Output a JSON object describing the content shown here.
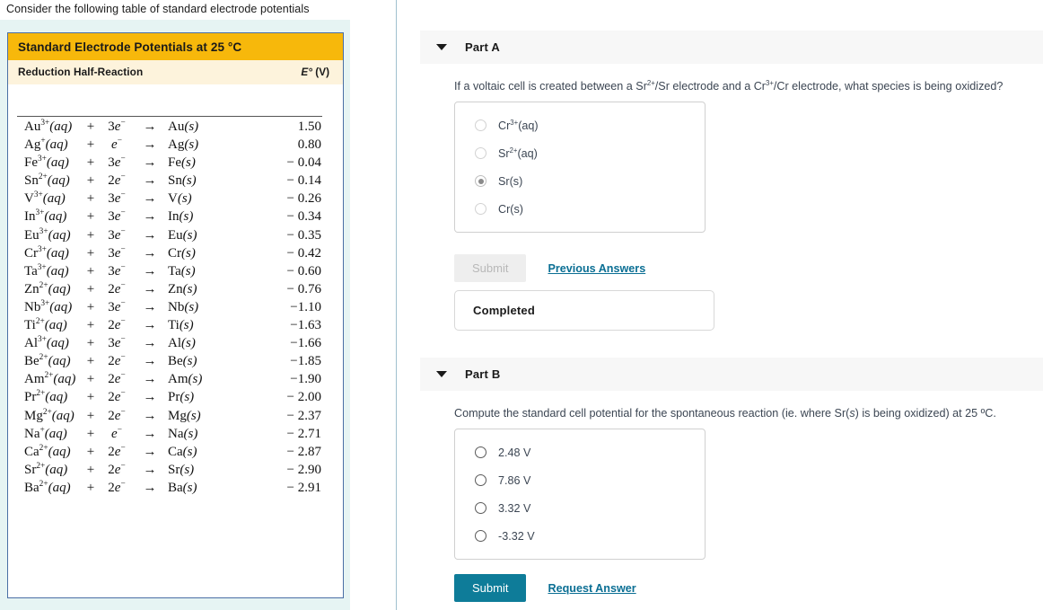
{
  "left": {
    "prompt": "Consider the following table of standard electrode potentials",
    "table": {
      "title": "Standard Electrode Potentials at 25 °C",
      "col_reaction": "Reduction Half-Reaction",
      "col_potential_symbol": "E°",
      "col_potential_unit": "(V)",
      "arrow": "→",
      "plus": "+",
      "rows": [
        {
          "cation": "Au",
          "charge": "3+",
          "state": "(aq)",
          "n": "3",
          "electron": "e",
          "product": "Au",
          "pstate": "(s)",
          "value": "1.50"
        },
        {
          "cation": "Ag",
          "charge": "+",
          "state": "(aq)",
          "n": "",
          "electron": "e",
          "product": "Ag",
          "pstate": "(s)",
          "value": "0.80"
        },
        {
          "cation": "Fe",
          "charge": "3+",
          "state": "(aq)",
          "n": "3",
          "electron": "e",
          "product": "Fe",
          "pstate": "(s)",
          "value": "− 0.04"
        },
        {
          "cation": "Sn",
          "charge": "2+",
          "state": "(aq)",
          "n": "2",
          "electron": "e",
          "product": "Sn",
          "pstate": "(s)",
          "value": "− 0.14"
        },
        {
          "cation": "V",
          "charge": "3+",
          "state": "(aq)",
          "n": "3",
          "electron": "e",
          "product": "V",
          "pstate": "(s)",
          "value": "− 0.26"
        },
        {
          "cation": "In",
          "charge": "3+",
          "state": "(aq)",
          "n": "3",
          "electron": "e",
          "product": "In",
          "pstate": "(s)",
          "value": "− 0.34"
        },
        {
          "cation": "Eu",
          "charge": "3+",
          "state": "(aq)",
          "n": "3",
          "electron": "e",
          "product": "Eu",
          "pstate": "(s)",
          "value": "− 0.35"
        },
        {
          "cation": "Cr",
          "charge": "3+",
          "state": "(aq)",
          "n": "3",
          "electron": "e",
          "product": "Cr",
          "pstate": "(s)",
          "value": "− 0.42"
        },
        {
          "cation": "Ta",
          "charge": "3+",
          "state": "(aq)",
          "n": "3",
          "electron": "e",
          "product": "Ta",
          "pstate": "(s)",
          "value": "− 0.60"
        },
        {
          "cation": "Zn",
          "charge": "2+",
          "state": "(aq)",
          "n": "2",
          "electron": "e",
          "product": "Zn",
          "pstate": "(s)",
          "value": "− 0.76"
        },
        {
          "cation": "Nb",
          "charge": "3+",
          "state": "(aq)",
          "n": "3",
          "electron": "e",
          "product": "Nb",
          "pstate": "(s)",
          "value": "−1.10"
        },
        {
          "cation": "Ti",
          "charge": "2+",
          "state": "(aq)",
          "n": "2",
          "electron": "e",
          "product": "Ti",
          "pstate": "(s)",
          "value": "−1.63"
        },
        {
          "cation": "Al",
          "charge": "3+",
          "state": "(aq)",
          "n": "3",
          "electron": "e",
          "product": "Al",
          "pstate": "(s)",
          "value": "−1.66"
        },
        {
          "cation": "Be",
          "charge": "2+",
          "state": "(aq)",
          "n": "2",
          "electron": "e",
          "product": "Be",
          "pstate": "(s)",
          "value": "−1.85"
        },
        {
          "cation": "Am",
          "charge": "2+",
          "state": "(aq)",
          "n": "2",
          "electron": "e",
          "product": "Am",
          "pstate": "(s)",
          "value": "−1.90"
        },
        {
          "cation": "Pr",
          "charge": "2+",
          "state": "(aq)",
          "n": "2",
          "electron": "e",
          "product": "Pr",
          "pstate": "(s)",
          "value": "− 2.00"
        },
        {
          "cation": "Mg",
          "charge": "2+",
          "state": "(aq)",
          "n": "2",
          "electron": "e",
          "product": "Mg",
          "pstate": "(s)",
          "value": "− 2.37"
        },
        {
          "cation": "Na",
          "charge": "+",
          "state": "(aq)",
          "n": "",
          "electron": "e",
          "product": "Na",
          "pstate": "(s)",
          "value": "− 2.71"
        },
        {
          "cation": "Ca",
          "charge": "2+",
          "state": "(aq)",
          "n": "2",
          "electron": "e",
          "product": "Ca",
          "pstate": "(s)",
          "value": "− 2.87"
        },
        {
          "cation": "Sr",
          "charge": "2+",
          "state": "(aq)",
          "n": "2",
          "electron": "e",
          "product": "Sr",
          "pstate": "(s)",
          "value": "− 2.90"
        },
        {
          "cation": "Ba",
          "charge": "2+",
          "state": "(aq)",
          "n": "2",
          "electron": "e",
          "product": "Ba",
          "pstate": "(s)",
          "value": "− 2.91"
        }
      ]
    }
  },
  "parts": {
    "a": {
      "label": "Part A",
      "question": "If a voltaic cell is created between a Sr2+/Sr electrode and a Cr3+/Cr electrode, what species is being oxidized?",
      "options": [
        {
          "base": "Cr",
          "sup": "3+",
          "tail": "(aq)",
          "selected": false
        },
        {
          "base": "Sr",
          "sup": "2+",
          "tail": "(aq)",
          "selected": false
        },
        {
          "base": "Sr",
          "sup": "",
          "tail": "(s)",
          "selected": true
        },
        {
          "base": "Cr",
          "sup": "",
          "tail": "(s)",
          "selected": false
        }
      ],
      "submit_label": "Submit",
      "submit_disabled": true,
      "previous_answers_label": "Previous Answers",
      "status_label": "Completed"
    },
    "b": {
      "label": "Part B",
      "question": "Compute the standard cell potential for the spontaneous reaction (ie. where Sr(s) is being oxidized) at 25 ºC.",
      "options": [
        {
          "base": "2.48 V",
          "sup": "",
          "tail": "",
          "selected": false
        },
        {
          "base": "7.86 V",
          "sup": "",
          "tail": "",
          "selected": false
        },
        {
          "base": "3.32 V",
          "sup": "",
          "tail": "",
          "selected": false
        },
        {
          "base": "-3.32 V",
          "sup": "",
          "tail": "",
          "selected": false
        }
      ],
      "submit_label": "Submit",
      "submit_disabled": false,
      "request_answer_label": "Request Answer"
    }
  },
  "colors": {
    "table_header": "#f7b80b",
    "table_subheader": "#fdf3dc",
    "table_border": "#4a6fa5",
    "left_tint": "#e6f4f3",
    "submit_active": "#0e7c99",
    "link": "#0b6f94"
  }
}
